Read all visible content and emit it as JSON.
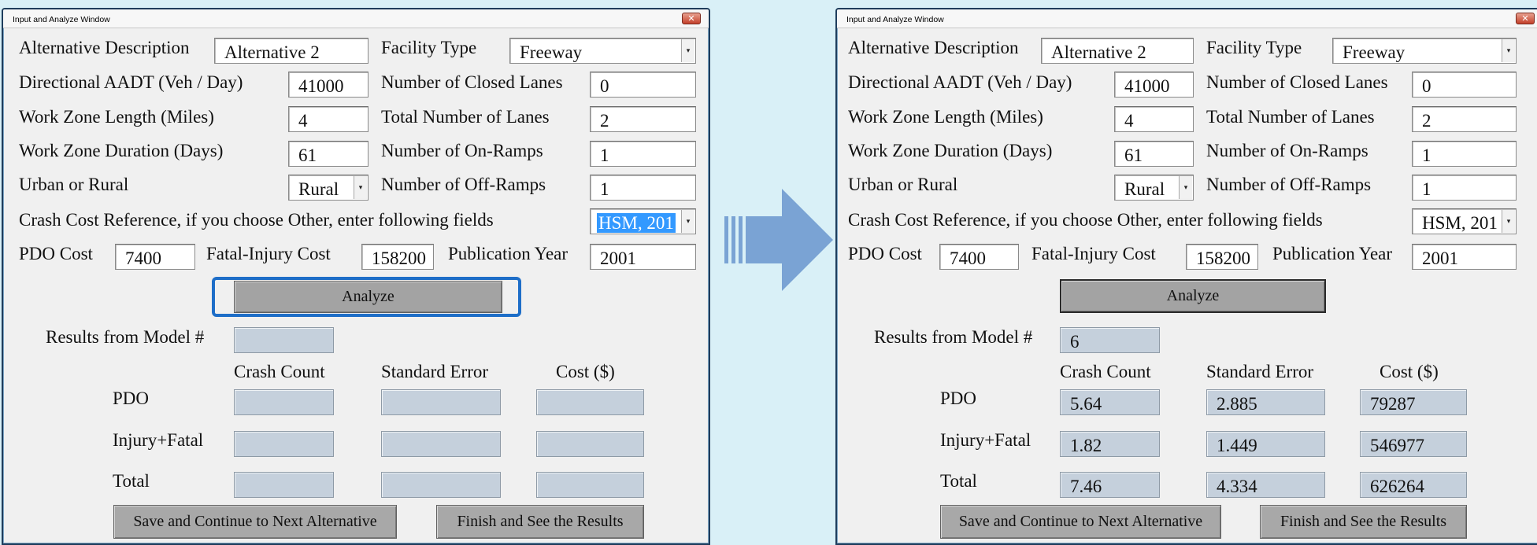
{
  "windows": [
    {
      "title": "Input and Analyze Window",
      "close_glyph": "✕",
      "alt_desc_label": "Alternative Description",
      "alt_desc_value": "Alternative 2",
      "facility_label": "Facility Type",
      "facility_value": "Freeway",
      "aadt_label": "Directional AADT (Veh / Day)",
      "aadt_value": "41000",
      "closed_lanes_label": "Number of Closed Lanes",
      "closed_lanes_value": "0",
      "wz_length_label": "Work Zone Length (Miles)",
      "wz_length_value": "4",
      "total_lanes_label": "Total Number of Lanes",
      "total_lanes_value": "2",
      "wz_duration_label": "Work Zone Duration (Days)",
      "wz_duration_value": "61",
      "on_ramps_label": "Number of On-Ramps",
      "on_ramps_value": "1",
      "urban_rural_label": "Urban or Rural",
      "urban_rural_value": "Rural",
      "off_ramps_label": "Number of Off-Ramps",
      "off_ramps_value": "1",
      "crash_cost_label": "Crash Cost Reference, if you choose Other, enter following fields",
      "crash_cost_value": "HSM, 201",
      "pdo_cost_label": "PDO Cost",
      "pdo_cost_value": "7400",
      "fatal_injury_cost_label": "Fatal-Injury Cost",
      "fatal_injury_cost_value": "158200",
      "pub_year_label": "Publication Year",
      "pub_year_value": "2001",
      "analyze_label": "Analyze",
      "results_label": "Results from Model #",
      "model_number": "",
      "col_crash": "Crash Count",
      "col_se": "Standard Error",
      "col_cost": "Cost ($)",
      "rows": [
        {
          "label": "PDO",
          "crash": "",
          "se": "",
          "cost": ""
        },
        {
          "label": "Injury+Fatal",
          "crash": "",
          "se": "",
          "cost": ""
        },
        {
          "label": "Total",
          "crash": "",
          "se": "",
          "cost": ""
        }
      ],
      "save_label": "Save and Continue to Next Alternative",
      "finish_label": "Finish and See the Results"
    },
    {
      "title": "Input and Analyze Window",
      "close_glyph": "✕",
      "alt_desc_label": "Alternative Description",
      "alt_desc_value": "Alternative 2",
      "facility_label": "Facility Type",
      "facility_value": "Freeway",
      "aadt_label": "Directional AADT (Veh / Day)",
      "aadt_value": "41000",
      "closed_lanes_label": "Number of Closed Lanes",
      "closed_lanes_value": "0",
      "wz_length_label": "Work Zone Length (Miles)",
      "wz_length_value": "4",
      "total_lanes_label": "Total Number of Lanes",
      "total_lanes_value": "2",
      "wz_duration_label": "Work Zone Duration (Days)",
      "wz_duration_value": "61",
      "on_ramps_label": "Number of On-Ramps",
      "on_ramps_value": "1",
      "urban_rural_label": "Urban or Rural",
      "urban_rural_value": "Rural",
      "off_ramps_label": "Number of Off-Ramps",
      "off_ramps_value": "1",
      "crash_cost_label": "Crash Cost Reference, if you choose Other, enter following fields",
      "crash_cost_value": "HSM, 201",
      "pdo_cost_label": "PDO Cost",
      "pdo_cost_value": "7400",
      "fatal_injury_cost_label": "Fatal-Injury Cost",
      "fatal_injury_cost_value": "158200",
      "pub_year_label": "Publication Year",
      "pub_year_value": "2001",
      "analyze_label": "Analyze",
      "results_label": "Results from Model #",
      "model_number": "6",
      "col_crash": "Crash Count",
      "col_se": "Standard Error",
      "col_cost": "Cost ($)",
      "rows": [
        {
          "label": "PDO",
          "crash": "5.64",
          "se": "2.885",
          "cost": "79287"
        },
        {
          "label": "Injury+Fatal",
          "crash": "1.82",
          "se": "1.449",
          "cost": "546977"
        },
        {
          "label": "Total",
          "crash": "7.46",
          "se": "4.334",
          "cost": "626264"
        }
      ],
      "save_label": "Save and Continue to Next Alternative",
      "finish_label": "Finish and See the Results"
    }
  ],
  "colors": {
    "background": "#d9f0f7",
    "window": "#f0f0f0",
    "output_field": "#c5d0dc",
    "focus_ring": "#1e6ec8",
    "arrow": "#7aa3d4",
    "selection": "#3399ff"
  },
  "icons": {
    "close": "close-icon",
    "dropdown": "chevron-down-icon",
    "transition": "right-arrow-icon"
  }
}
